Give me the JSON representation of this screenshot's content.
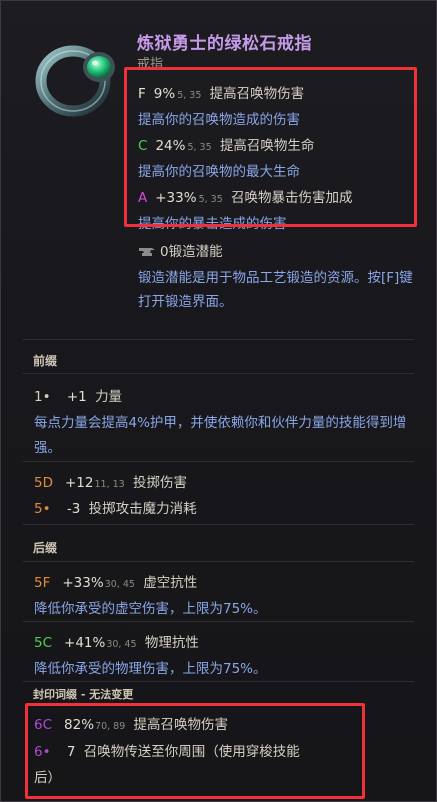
{
  "item": {
    "name": "炼狱勇士的绿松石戒指",
    "type": "戒指"
  },
  "implicits": [
    {
      "tier": "F",
      "tier_color": "#e9e2d0",
      "value": "9%",
      "range": "5, 35",
      "name": "提高召唤物伤害",
      "desc": "提高你的召唤物造成的伤害"
    },
    {
      "tier": "C",
      "tier_color": "#4cd24c",
      "value": "24%",
      "range": "5, 35",
      "name": "提高召唤物生命",
      "desc": "提高你的召唤物的最大生命"
    },
    {
      "tier": "A",
      "tier_color": "#d54bd8",
      "value": "+33%",
      "range": "5, 35",
      "name": "召唤物暴击伤害加成",
      "desc": "提高你的暴击造成的伤害"
    }
  ],
  "forge": {
    "value": "0锻造潜能",
    "desc_line1": "锻造潜能是用于物品工艺锻造的资源。按[F]键",
    "desc_line2": "打开锻造界面。"
  },
  "prefix": {
    "title": "前缀",
    "rows": [
      {
        "tier": "1",
        "tier_color": "#d8cfb8",
        "value": "+1",
        "range": "",
        "name": "力量",
        "desc_line1": "每点力量会提高4%护甲，并使依赖你和伙伴力量的技能得到增",
        "desc_line2": "强。"
      },
      {
        "tier": "5D",
        "tier_color": "#e38a3a",
        "value": "+12",
        "range": "11, 13",
        "name": "投掷伤害"
      },
      {
        "tier": "5",
        "tier_color": "#e38a3a",
        "value": "-3",
        "range": "",
        "name": "投掷攻击魔力消耗"
      }
    ]
  },
  "suffix": {
    "title": "后缀",
    "rows": [
      {
        "tier": "5F",
        "tier_color": "#e38a3a",
        "value": "+33%",
        "range": "30, 45",
        "name": "虚空抗性",
        "desc": "降低你承受的虚空伤害，上限为75%。"
      },
      {
        "tier": "5C",
        "tier_color": "#4cd24c",
        "value": "+41%",
        "range": "30, 45",
        "name": "物理抗性",
        "desc": "降低你承受的物理伤害，上限为75%。"
      }
    ]
  },
  "sealed": {
    "title": "封印词缀 - 无法变更",
    "rows": [
      {
        "tier": "6C",
        "tier_color": "#b04ad8",
        "value": "82%",
        "range": "70, 89",
        "name": "提高召唤物伤害"
      },
      {
        "tier": "6",
        "tier_color": "#b04ad8",
        "value": "7",
        "range": "",
        "name": "召唤物传送至你周围（使用穿梭技能",
        "name_line2": "后）"
      }
    ]
  },
  "colors": {
    "highlight_box": "#f0303a",
    "title": "#c59be8",
    "description": "#8aa6e8"
  }
}
